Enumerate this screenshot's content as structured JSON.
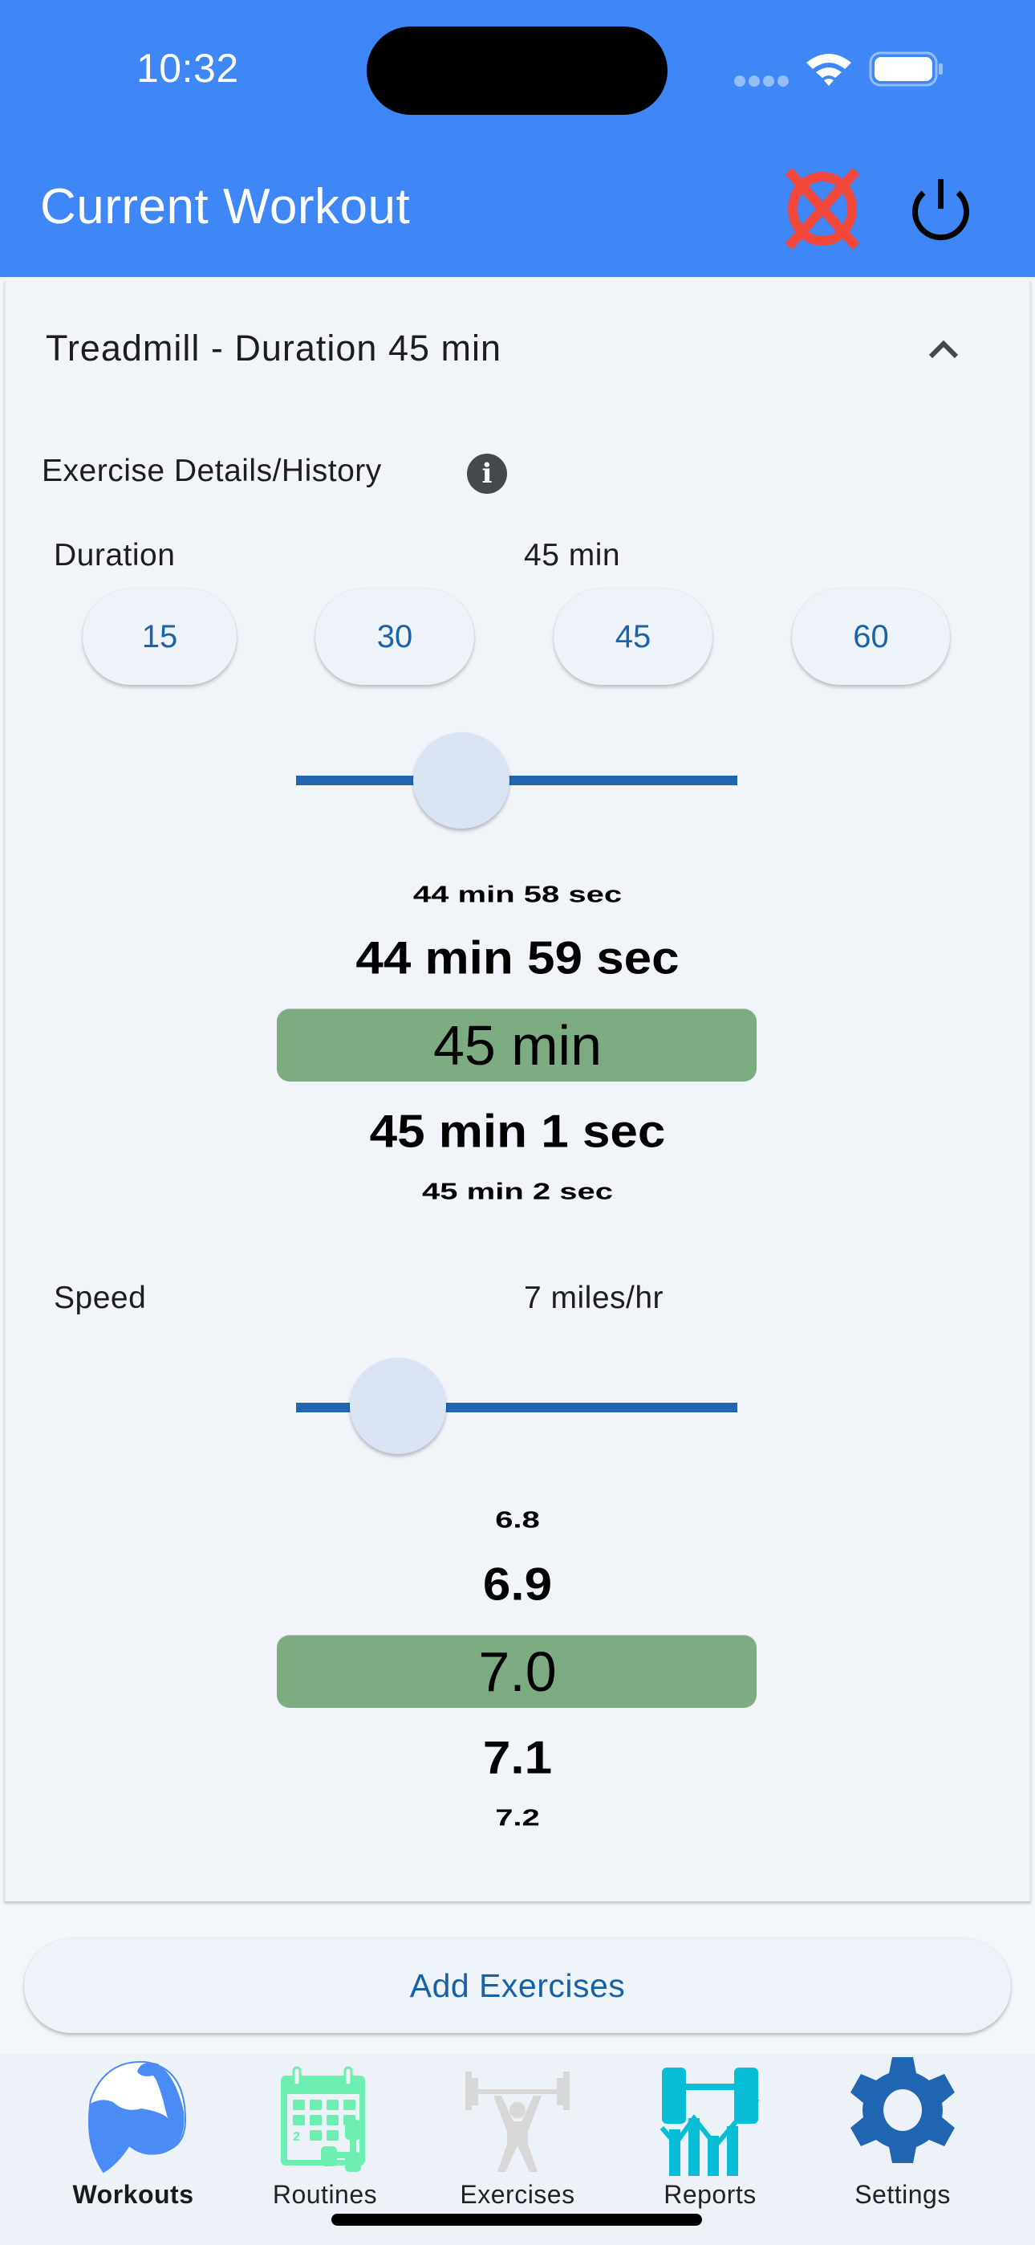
{
  "status_bar": {
    "time": "10:32",
    "icons": [
      "cellular-signal-icon",
      "wifi-icon",
      "battery-icon"
    ]
  },
  "app_bar": {
    "title": "Current Workout",
    "actions": [
      {
        "name": "cancel-workout",
        "icon": "cancel-circle-x-icon",
        "color": "#F2473B"
      },
      {
        "name": "end-workout",
        "icon": "power-icon",
        "color": "#000000"
      }
    ],
    "background": "#3F87F6"
  },
  "exercise": {
    "title": "Treadmill - Duration 45 min",
    "expanded": true,
    "details_label": "Exercise Details/History",
    "info_icon_glyph": "i",
    "duration": {
      "label": "Duration",
      "value_text": "45 min",
      "quick_options": [
        "15",
        "30",
        "45",
        "60"
      ],
      "slider_fraction": 0.375,
      "picker": {
        "items": [
          "44 min 58 sec",
          "44 min 59 sec",
          "45 min",
          "45 min 1 sec",
          "45 min 2 sec"
        ],
        "selected_index": 2
      }
    },
    "speed": {
      "label": "Speed",
      "value_text": "7 miles/hr",
      "slider_fraction": 0.23,
      "picker": {
        "items": [
          "6.8",
          "6.9",
          "7.0",
          "7.1",
          "7.2"
        ],
        "selected_index": 2
      }
    }
  },
  "add_exercises_label": "Add Exercises",
  "colors": {
    "accent": "#1B62A6",
    "selection": "#7DAB82",
    "slider_track": "#2067B3",
    "slider_thumb": "#DAE4F4"
  },
  "bottom_nav": {
    "items": [
      {
        "label": "Workouts",
        "icon": "flexed-bicep-icon",
        "active": true
      },
      {
        "label": "Routines",
        "icon": "calendar-dumbbell-icon",
        "active": false
      },
      {
        "label": "Exercises",
        "icon": "weightlifter-icon",
        "active": false
      },
      {
        "label": "Reports",
        "icon": "dumbbell-chart-icon",
        "active": false
      },
      {
        "label": "Settings",
        "icon": "gear-icon",
        "active": false
      }
    ]
  }
}
